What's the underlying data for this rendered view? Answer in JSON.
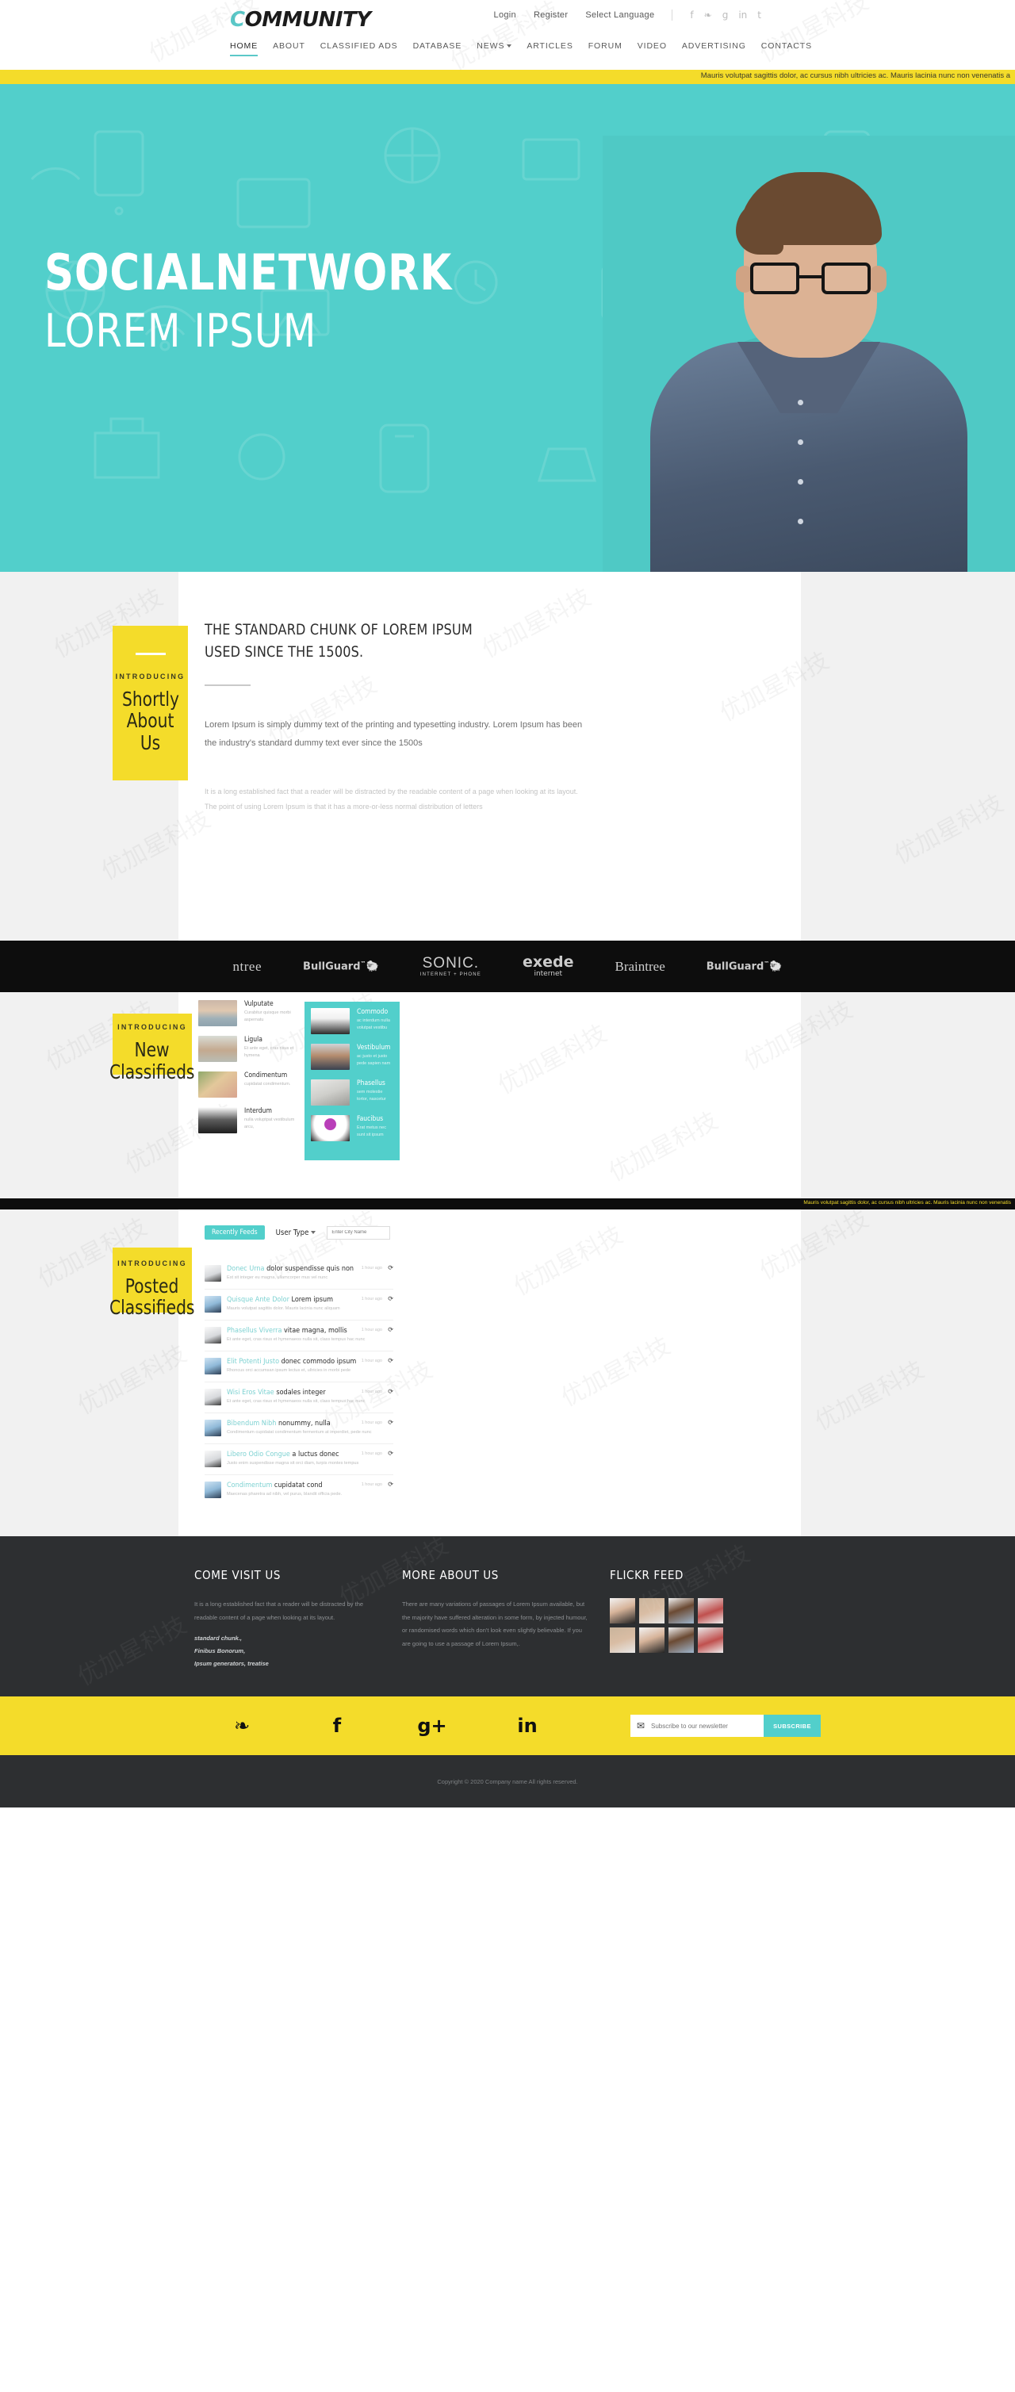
{
  "header": {
    "logo_c": "C",
    "logo_rest": "OMMUNITY",
    "top_links": [
      "Login",
      "Register",
      "Select Language"
    ],
    "social_icons": [
      "facebook-icon",
      "twitter-icon",
      "googleplus-icon",
      "linkedin-icon",
      "tumblr-icon"
    ],
    "social_glyphs": [
      "f",
      "❧",
      "g",
      "in",
      "t"
    ],
    "nav": [
      {
        "label": "HOME",
        "active": true,
        "caret": false
      },
      {
        "label": "ABOUT",
        "active": false,
        "caret": false
      },
      {
        "label": "CLASSIFIED ADS",
        "active": false,
        "caret": false
      },
      {
        "label": "DATABASE",
        "active": false,
        "caret": false
      },
      {
        "label": "NEWS",
        "active": false,
        "caret": true
      },
      {
        "label": "ARTICLES",
        "active": false,
        "caret": false
      },
      {
        "label": "FORUM",
        "active": false,
        "caret": false
      },
      {
        "label": "VIDEO",
        "active": false,
        "caret": false
      },
      {
        "label": "ADVERTISING",
        "active": false,
        "caret": false
      },
      {
        "label": "CONTACTS",
        "active": false,
        "caret": false
      }
    ]
  },
  "ticker": {
    "text": "Mauris volutpat sagittis dolor, ac cursus nibh ultricies ac. Mauris lacinia nunc non venenatis a"
  },
  "hero": {
    "title": "SOCIALNETWORK",
    "subtitle": "LOREM IPSUM"
  },
  "about": {
    "card_intro": "INTRODUCING",
    "card_line1": "Shortly",
    "card_line2": "About Us",
    "heading_line1": "THE STANDARD CHUNK OF LOREM IPSUM",
    "heading_line2": "USED SINCE THE 1500S.",
    "paragraph": "Lorem Ipsum is simply dummy text of the printing and typesetting industry. Lorem Ipsum has been the industry's standard dummy text ever since the 1500s",
    "paragraph_faded": "It is a long established fact that a reader will be distracted by the readable content of a page when looking at its layout. The point of using Lorem Ipsum is that it has a more-or-less normal distribution of letters"
  },
  "brands": [
    {
      "name": "braintree-logo",
      "text": "ntree",
      "style": "serif"
    },
    {
      "name": "bullguard-logo",
      "text": "BullGuard",
      "style": "bull"
    },
    {
      "name": "sonic-logo",
      "text": "SONIC.",
      "sub": "INTERNET + PHONE",
      "style": "sonic"
    },
    {
      "name": "exede-logo",
      "text": "exede",
      "sub": "internet",
      "style": "exede"
    },
    {
      "name": "braintree-logo-2",
      "text": "Braintree",
      "style": "serif"
    },
    {
      "name": "bullguard-logo-2",
      "text": "BullGuard",
      "style": "bull"
    }
  ],
  "classifieds": {
    "card_intro": "INTRODUCING",
    "card_line1": "New",
    "card_line2": "Classifieds",
    "left_items": [
      {
        "title": "Vulputate",
        "desc": "Curabitur quisque morbi aspernatu",
        "thumb": "phone-sunset-photo"
      },
      {
        "title": "Ligula",
        "desc": "Et ante eget, cras risus et hymena",
        "thumb": "woman-headphones-photo"
      },
      {
        "title": "Condimentum",
        "desc": "cupidatat condimentum.",
        "thumb": "girl-outdoor-photo"
      },
      {
        "title": "Interdum",
        "desc": "nulla voluptpat vestibulum arcu,",
        "thumb": "photographer-camera-photo"
      }
    ],
    "right_items": [
      {
        "title": "Commodo",
        "desc": "ac interdum nulla volutpat vestibu",
        "thumb": "woman-laptop-photo"
      },
      {
        "title": "Vestibulum",
        "desc": "ac justo et justo pede sapien nam",
        "thumb": "businessman-portrait-photo"
      },
      {
        "title": "Phasellus",
        "desc": "sem molestie tortor, nascetur",
        "thumb": "hands-book-photo"
      },
      {
        "title": "Faucibus",
        "desc": "Erat metus nec sunt sit ipsum",
        "thumb": "female-symbol-sign-photo"
      }
    ]
  },
  "ticker2": {
    "text": "Mauris volutpat sagittis dolor, ac cursus nibh ultricies ac. Mauris lacinia nunc non venenatis"
  },
  "posted": {
    "card_intro": "INTRODUCING",
    "card_line1": "Posted",
    "card_line2": "Classifieds",
    "tab_label": "Recently Feeds",
    "user_type_label": "User Type",
    "city_placeholder": "Enter City Name",
    "refresh_icon": "refresh-icon",
    "feeds": [
      {
        "link": "Donec Urna",
        "rest": "dolor suspendisse quis non",
        "sub": "Est sit integer eu magna, ullamcorper mus vel nunc",
        "time": "1 hour ago"
      },
      {
        "link": "Quisque Ante Dolor",
        "rest": "Lorem ipsum",
        "sub": "Mauris volutpat sagittis dolor. Mauris lacinia nunc aliquam",
        "time": "1 hour ago"
      },
      {
        "link": "Phasellus Viverra",
        "rest": "vitae magna, mollis",
        "sub": "Et ante eget, cras risus et hymenaeos nulla sit, class tempus hac nunc",
        "time": "1 hour ago"
      },
      {
        "link": "Elit Potenti Justo",
        "rest": "donec commodo ipsum",
        "sub": "Rhoncus orci accumsan ipsum lectus et, ultricies in morbi pede",
        "time": "1 hour ago"
      },
      {
        "link": "Wisi Eros Vitae",
        "rest": "sodales integer",
        "sub": "Et ante eget, cras risus et hymenaeos nulla sit, class tempus hac nunc",
        "time": "1 hour ago"
      },
      {
        "link": "Bibendum Nibh",
        "rest": "nonummy, nulla",
        "sub": "Condimentum cupidatat condimentum fermentum at imperdiet, pede nunc",
        "time": "1 hour ago"
      },
      {
        "link": "Libero Odio Congue",
        "rest": "a luctus donec",
        "sub": "Justo enim suspendisse magna sit orci diam, turpis montes tempus",
        "time": "1 hour ago"
      },
      {
        "link": "Condimentum",
        "rest": "cupidatat cond",
        "sub": "Maecenas pharetra ad nibh, vel purus, blandit officia pede.",
        "time": "1 hour ago"
      }
    ]
  },
  "footer": {
    "col1_title": "COME VISIT US",
    "col1_body": "It is a long established fact that a reader will be distracted by the readable content of a page when looking at its layout.",
    "col1_em_line1": "standard chunk.,",
    "col1_em_line2": "Finibus Bonorum,",
    "col1_em_line3": "Ipsum generators, treatise",
    "col2_title": "MORE ABOUT US",
    "col2_body": "There are many variations of passages of Lorem Ipsum available, but the majority have suffered alteration in some form, by injected humour, or randomised words which don't look even slightly believable. If you are going to use a passage of Lorem Ipsum,.",
    "col3_title": "FLICKR FEED",
    "flickr_photos": [
      "man-glasses-photo-1",
      "young-man-photo-2",
      "man-stripes-photo-3",
      "person-writing-photo-4",
      "young-man-photo-2",
      "man-glasses-photo-1",
      "man-stripes-photo-3",
      "person-writing-photo-4"
    ]
  },
  "social_strip": {
    "icons": [
      {
        "name": "twitter-icon",
        "glyph": "❧"
      },
      {
        "name": "facebook-icon",
        "glyph": "f"
      },
      {
        "name": "googleplus-icon",
        "glyph": "g+"
      },
      {
        "name": "linkedin-icon",
        "glyph": "in"
      }
    ],
    "envelope_icon": "envelope-icon",
    "newsletter_placeholder": "Subscribe to our newsletter",
    "subscribe_label": "SUBSCRIBE"
  },
  "copyright": {
    "text": "Copyright © 2020 Company name All rights reserved."
  },
  "colors": {
    "yellow": "#f4dc2a",
    "teal": "#52cfcb",
    "dark": "#2d2f31",
    "black": "#0d0d0d"
  },
  "watermark": {
    "text": "优加星科技"
  }
}
